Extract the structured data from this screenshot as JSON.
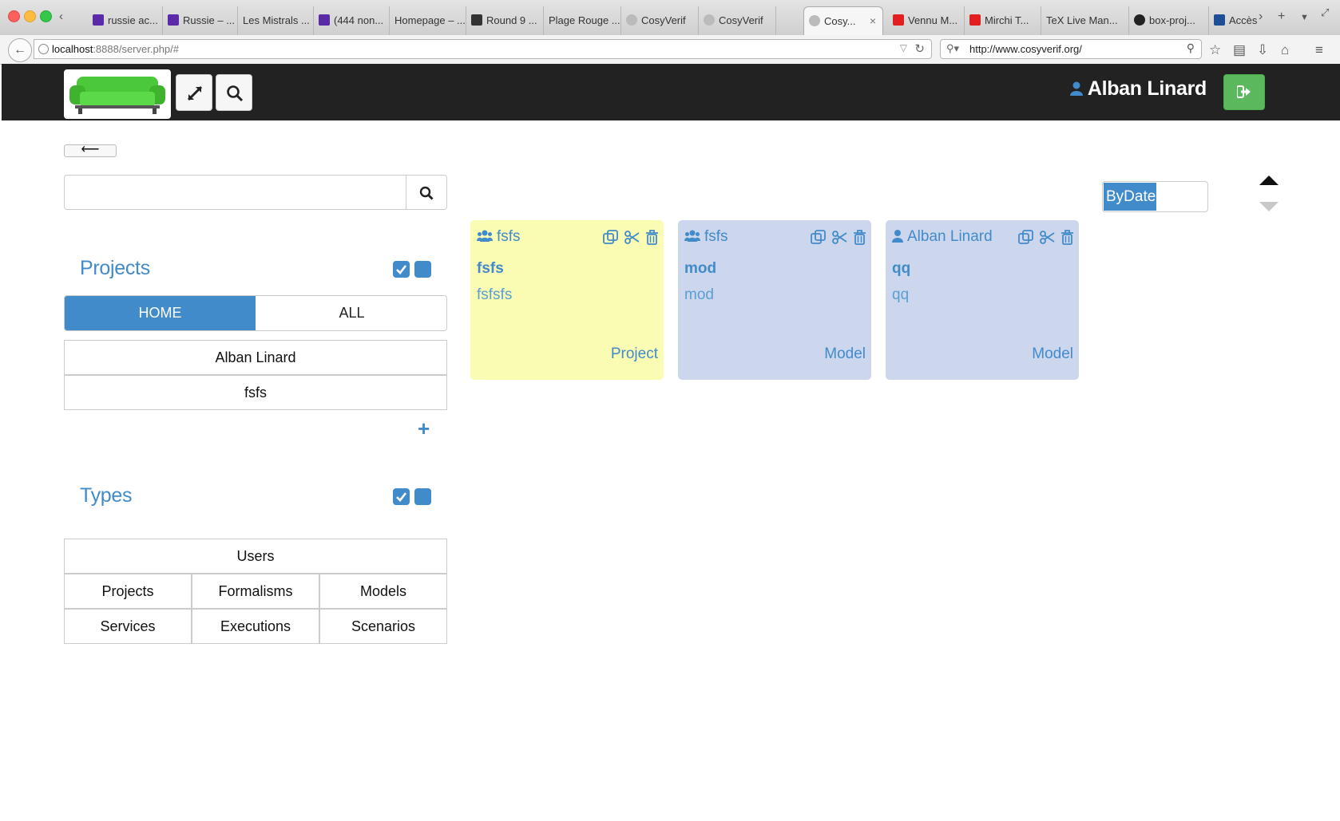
{
  "browser": {
    "tabs": [
      {
        "label": "russie ac...",
        "fav_color": "#5a2aa8"
      },
      {
        "label": "Russie – ...",
        "fav_color": "#5a2aa8"
      },
      {
        "label": "Les Mistrals ...",
        "fav_color": ""
      },
      {
        "label": "(444 non...",
        "fav_color": "#5a2aa8"
      },
      {
        "label": "Homepage – ...",
        "fav_color": ""
      },
      {
        "label": "Round 9 ...",
        "fav_color": "#333333"
      },
      {
        "label": "Plage Rouge ...",
        "fav_color": ""
      },
      {
        "label": "CosyVerif",
        "fav_color": "#888888"
      },
      {
        "label": "CosyVerif",
        "fav_color": "#888888"
      },
      {
        "label": "Cosy...",
        "fav_color": "#888888",
        "active": true
      },
      {
        "label": "Vennu M...",
        "fav_color": "#e02020"
      },
      {
        "label": "Mirchi T...",
        "fav_color": "#e02020"
      },
      {
        "label": "TeX Live Man...",
        "fav_color": ""
      },
      {
        "label": "box-proj...",
        "fav_color": "#222222"
      },
      {
        "label": "Accès",
        "fav_color": "#1e4e96"
      }
    ],
    "url_host": "localhost",
    "url_rest": ":8888/server.php/#",
    "search_value": "http://www.cosyverif.org/"
  },
  "header": {
    "user_name": "Alban Linard",
    "logout_color": "#5cb85c"
  },
  "left": {
    "search_placeholder": "",
    "projects_title": "Projects",
    "seg_home": "HOME",
    "seg_all": "ALL",
    "project_items": [
      "Alban Linard",
      "fsfs"
    ],
    "plus_label": "+",
    "types_title": "Types",
    "types_users": "Users",
    "types_grid": [
      "Projects",
      "Formalisms",
      "Models",
      "Services",
      "Executions",
      "Scenarios"
    ]
  },
  "cards": [
    {
      "owner_icon": "users-icon",
      "owner": "fsfs",
      "name": "fsfs",
      "desc": "fsfsfs",
      "type": "Project",
      "bg": "#fbfcb4"
    },
    {
      "owner_icon": "users-icon",
      "owner": "fsfs",
      "name": "mod",
      "desc": "mod",
      "type": "Model",
      "bg": "#ccd6ec"
    },
    {
      "owner_icon": "user-icon",
      "owner": "Alban Linard",
      "name": "qq",
      "desc": "qq",
      "type": "Model",
      "bg": "#ccd6ec"
    }
  ],
  "sort": {
    "selected": "ByDate"
  },
  "colors": {
    "accent": "#428bca",
    "header_bg": "#222222"
  }
}
